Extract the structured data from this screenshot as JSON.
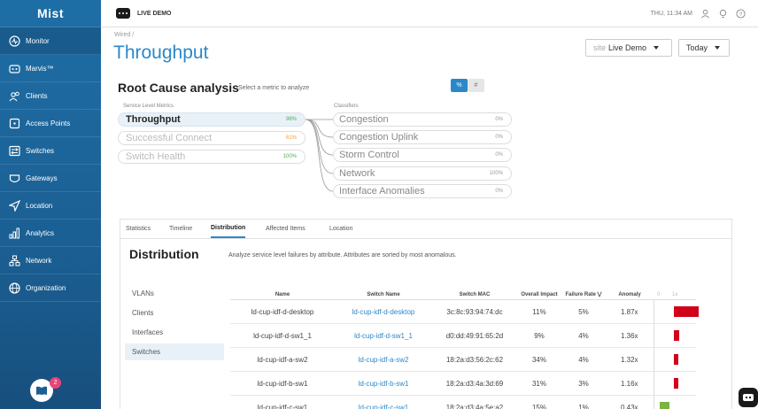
{
  "app": {
    "logo_text": "Mist",
    "top_label": "LIVE DEMO",
    "datetime": "THU, 11:34 AM"
  },
  "sidebar": {
    "items": [
      {
        "label": "Monitor",
        "icon": "monitor-icon"
      },
      {
        "label": "Marvis™",
        "icon": "marvis-icon"
      },
      {
        "label": "Clients",
        "icon": "clients-icon"
      },
      {
        "label": "Access Points",
        "icon": "access-point-icon"
      },
      {
        "label": "Switches",
        "icon": "switch-icon"
      },
      {
        "label": "Gateways",
        "icon": "gateway-icon"
      },
      {
        "label": "Location",
        "icon": "location-icon"
      },
      {
        "label": "Analytics",
        "icon": "analytics-icon"
      },
      {
        "label": "Network",
        "icon": "network-icon"
      },
      {
        "label": "Organization",
        "icon": "organization-icon"
      }
    ],
    "notification_count": "2"
  },
  "page": {
    "breadcrumb": "Wired /",
    "title": "Throughput",
    "site_prefix": "site",
    "site_value": "Live Demo",
    "range_value": "Today"
  },
  "rca": {
    "title": "Root Cause analysis",
    "subtitle": "Select a metric to analyze",
    "toggle_pct": "%",
    "toggle_num": "#",
    "sle_label": "Service Level Metrics",
    "classifier_label": "Classifiers",
    "metrics": [
      {
        "label": "Throughput",
        "value": "98%",
        "color": "#4caf50"
      },
      {
        "label": "Successful Connect",
        "value": "61%",
        "color": "#f0a030"
      },
      {
        "label": "Switch Health",
        "value": "100%",
        "color": "#4caf50"
      }
    ],
    "classifiers": [
      {
        "label": "Congestion",
        "value": "0%"
      },
      {
        "label": "Congestion Uplink",
        "value": "0%"
      },
      {
        "label": "Storm Control",
        "value": "0%"
      },
      {
        "label": "Network",
        "value": "100%"
      },
      {
        "label": "Interface Anomalies",
        "value": "0%"
      }
    ]
  },
  "tabs": [
    "Statistics",
    "Timeline",
    "Distribution",
    "Affected Items",
    "Location"
  ],
  "distribution": {
    "title": "Distribution",
    "subtitle": "Analyze service level failures by attribute. Attributes are sorted by most anomalous.",
    "side": [
      "VLANs",
      "Clients",
      "Interfaces",
      "Switches"
    ],
    "columns": [
      "Name",
      "Switch Name",
      "Switch MAC",
      "Overall Impact",
      "Failure Rate",
      "Anomaly"
    ],
    "scale_labels": [
      "0",
      "1x"
    ],
    "rows": [
      {
        "name": "ld-cup-idf-d-desktop",
        "switch": "ld-cup-idf-d-desktop",
        "mac": "3c:8c:93:94:74:dc",
        "impact": "11%",
        "rate": "5%",
        "anomaly": "1.87x",
        "level": 1.87
      },
      {
        "name": "ld-cup-idf-d-sw1_1",
        "switch": "ld-cup-idf-d-sw1_1",
        "mac": "d0:dd:49:91:65:2d",
        "impact": "9%",
        "rate": "4%",
        "anomaly": "1.36x",
        "level": 1.36
      },
      {
        "name": "ld-cup-idf-a-sw2",
        "switch": "ld-cup-idf-a-sw2",
        "mac": "18:2a:d3:56:2c:62",
        "impact": "34%",
        "rate": "4%",
        "anomaly": "1.32x",
        "level": 1.32
      },
      {
        "name": "ld-cup-idf-b-sw1",
        "switch": "ld-cup-idf-b-sw1",
        "mac": "18:2a:d3:4a:3d:69",
        "impact": "31%",
        "rate": "3%",
        "anomaly": "1.16x",
        "level": 1.16
      },
      {
        "name": "ld-cup-idf-c-sw1",
        "switch": "ld-cup-idf-c-sw1",
        "mac": "18:2a:d3:4a:5e:a2",
        "impact": "15%",
        "rate": "1%",
        "anomaly": "0.43x",
        "level": 0.43
      }
    ],
    "colors": {
      "high": "#d0021b",
      "low": "#7cb342"
    }
  }
}
